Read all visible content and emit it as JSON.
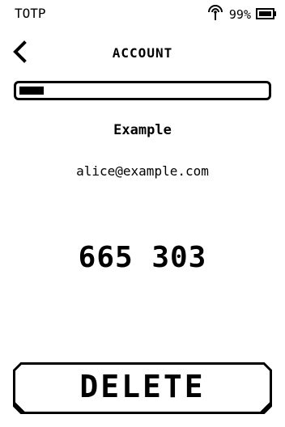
{
  "status_bar": {
    "app_name": "TOTP",
    "battery_text": "99%",
    "icons": [
      "antenna-icon",
      "battery-icon"
    ]
  },
  "nav": {
    "title": "ACCOUNT",
    "back_icon": "chevron-left-icon"
  },
  "progress": {
    "remaining_fraction": 0.1
  },
  "account": {
    "issuer": "Example",
    "name": "alice@example.com",
    "code": "665 303"
  },
  "actions": {
    "delete_label": "DELETE"
  },
  "colors": {
    "foreground": "#000000",
    "background": "#ffffff"
  }
}
